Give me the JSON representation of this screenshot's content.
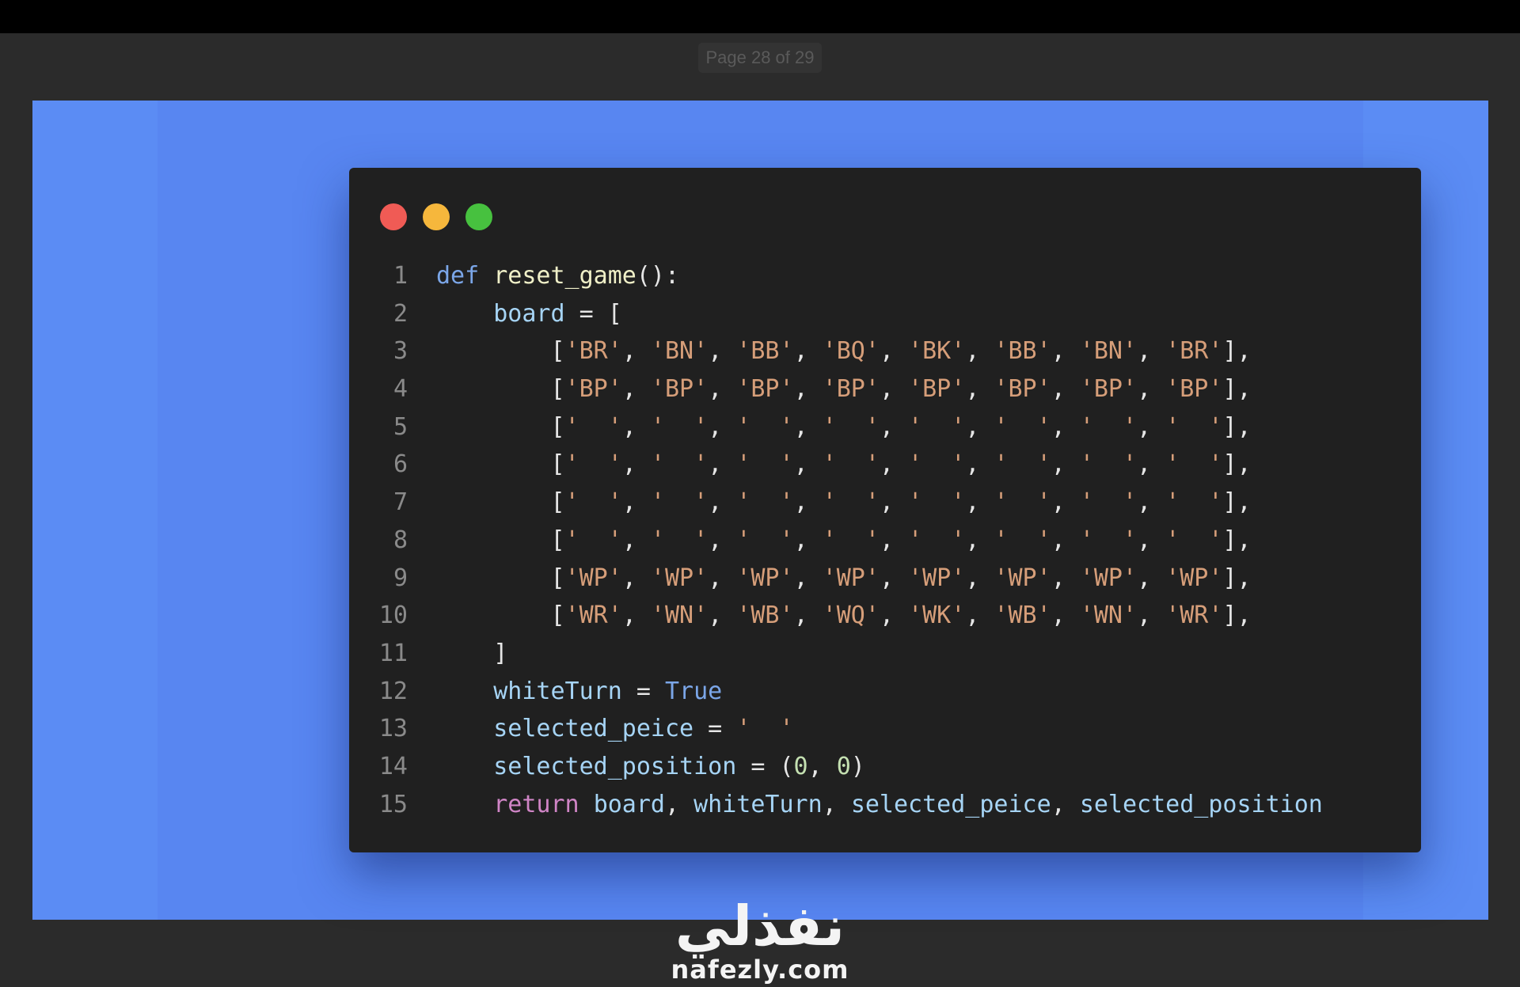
{
  "viewer": {
    "page_indicator": "Page 28 of 29"
  },
  "editor": {
    "window_controls": [
      "close",
      "minimize",
      "maximize"
    ],
    "colors": {
      "background": "#202020",
      "close": "#f05b55",
      "minimize": "#f6b73c",
      "maximize": "#47c13f"
    },
    "lines": [
      {
        "n": "1",
        "tokens": [
          {
            "t": "def",
            "c": "kw"
          },
          {
            "t": " ",
            "c": "op"
          },
          {
            "t": "reset_game",
            "c": "fn"
          },
          {
            "t": "():",
            "c": "op"
          }
        ]
      },
      {
        "n": "2",
        "tokens": [
          {
            "t": "    ",
            "c": "op"
          },
          {
            "t": "board",
            "c": "var"
          },
          {
            "t": " = [",
            "c": "op"
          }
        ]
      },
      {
        "n": "3",
        "tokens": [
          {
            "t": "        [",
            "c": "op"
          },
          {
            "t": "'BR'",
            "c": "str"
          },
          {
            "t": ", ",
            "c": "op"
          },
          {
            "t": "'BN'",
            "c": "str"
          },
          {
            "t": ", ",
            "c": "op"
          },
          {
            "t": "'BB'",
            "c": "str"
          },
          {
            "t": ", ",
            "c": "op"
          },
          {
            "t": "'BQ'",
            "c": "str"
          },
          {
            "t": ", ",
            "c": "op"
          },
          {
            "t": "'BK'",
            "c": "str"
          },
          {
            "t": ", ",
            "c": "op"
          },
          {
            "t": "'BB'",
            "c": "str"
          },
          {
            "t": ", ",
            "c": "op"
          },
          {
            "t": "'BN'",
            "c": "str"
          },
          {
            "t": ", ",
            "c": "op"
          },
          {
            "t": "'BR'",
            "c": "str"
          },
          {
            "t": "],",
            "c": "op"
          }
        ]
      },
      {
        "n": "4",
        "tokens": [
          {
            "t": "        [",
            "c": "op"
          },
          {
            "t": "'BP'",
            "c": "str"
          },
          {
            "t": ", ",
            "c": "op"
          },
          {
            "t": "'BP'",
            "c": "str"
          },
          {
            "t": ", ",
            "c": "op"
          },
          {
            "t": "'BP'",
            "c": "str"
          },
          {
            "t": ", ",
            "c": "op"
          },
          {
            "t": "'BP'",
            "c": "str"
          },
          {
            "t": ", ",
            "c": "op"
          },
          {
            "t": "'BP'",
            "c": "str"
          },
          {
            "t": ", ",
            "c": "op"
          },
          {
            "t": "'BP'",
            "c": "str"
          },
          {
            "t": ", ",
            "c": "op"
          },
          {
            "t": "'BP'",
            "c": "str"
          },
          {
            "t": ", ",
            "c": "op"
          },
          {
            "t": "'BP'",
            "c": "str"
          },
          {
            "t": "],",
            "c": "op"
          }
        ]
      },
      {
        "n": "5",
        "tokens": [
          {
            "t": "        [",
            "c": "op"
          },
          {
            "t": "'  '",
            "c": "str"
          },
          {
            "t": ", ",
            "c": "op"
          },
          {
            "t": "'  '",
            "c": "str"
          },
          {
            "t": ", ",
            "c": "op"
          },
          {
            "t": "'  '",
            "c": "str"
          },
          {
            "t": ", ",
            "c": "op"
          },
          {
            "t": "'  '",
            "c": "str"
          },
          {
            "t": ", ",
            "c": "op"
          },
          {
            "t": "'  '",
            "c": "str"
          },
          {
            "t": ", ",
            "c": "op"
          },
          {
            "t": "'  '",
            "c": "str"
          },
          {
            "t": ", ",
            "c": "op"
          },
          {
            "t": "'  '",
            "c": "str"
          },
          {
            "t": ", ",
            "c": "op"
          },
          {
            "t": "'  '",
            "c": "str"
          },
          {
            "t": "],",
            "c": "op"
          }
        ]
      },
      {
        "n": "6",
        "tokens": [
          {
            "t": "        [",
            "c": "op"
          },
          {
            "t": "'  '",
            "c": "str"
          },
          {
            "t": ", ",
            "c": "op"
          },
          {
            "t": "'  '",
            "c": "str"
          },
          {
            "t": ", ",
            "c": "op"
          },
          {
            "t": "'  '",
            "c": "str"
          },
          {
            "t": ", ",
            "c": "op"
          },
          {
            "t": "'  '",
            "c": "str"
          },
          {
            "t": ", ",
            "c": "op"
          },
          {
            "t": "'  '",
            "c": "str"
          },
          {
            "t": ", ",
            "c": "op"
          },
          {
            "t": "'  '",
            "c": "str"
          },
          {
            "t": ", ",
            "c": "op"
          },
          {
            "t": "'  '",
            "c": "str"
          },
          {
            "t": ", ",
            "c": "op"
          },
          {
            "t": "'  '",
            "c": "str"
          },
          {
            "t": "],",
            "c": "op"
          }
        ]
      },
      {
        "n": "7",
        "tokens": [
          {
            "t": "        [",
            "c": "op"
          },
          {
            "t": "'  '",
            "c": "str"
          },
          {
            "t": ", ",
            "c": "op"
          },
          {
            "t": "'  '",
            "c": "str"
          },
          {
            "t": ", ",
            "c": "op"
          },
          {
            "t": "'  '",
            "c": "str"
          },
          {
            "t": ", ",
            "c": "op"
          },
          {
            "t": "'  '",
            "c": "str"
          },
          {
            "t": ", ",
            "c": "op"
          },
          {
            "t": "'  '",
            "c": "str"
          },
          {
            "t": ", ",
            "c": "op"
          },
          {
            "t": "'  '",
            "c": "str"
          },
          {
            "t": ", ",
            "c": "op"
          },
          {
            "t": "'  '",
            "c": "str"
          },
          {
            "t": ", ",
            "c": "op"
          },
          {
            "t": "'  '",
            "c": "str"
          },
          {
            "t": "],",
            "c": "op"
          }
        ]
      },
      {
        "n": "8",
        "tokens": [
          {
            "t": "        [",
            "c": "op"
          },
          {
            "t": "'  '",
            "c": "str"
          },
          {
            "t": ", ",
            "c": "op"
          },
          {
            "t": "'  '",
            "c": "str"
          },
          {
            "t": ", ",
            "c": "op"
          },
          {
            "t": "'  '",
            "c": "str"
          },
          {
            "t": ", ",
            "c": "op"
          },
          {
            "t": "'  '",
            "c": "str"
          },
          {
            "t": ", ",
            "c": "op"
          },
          {
            "t": "'  '",
            "c": "str"
          },
          {
            "t": ", ",
            "c": "op"
          },
          {
            "t": "'  '",
            "c": "str"
          },
          {
            "t": ", ",
            "c": "op"
          },
          {
            "t": "'  '",
            "c": "str"
          },
          {
            "t": ", ",
            "c": "op"
          },
          {
            "t": "'  '",
            "c": "str"
          },
          {
            "t": "],",
            "c": "op"
          }
        ]
      },
      {
        "n": "9",
        "tokens": [
          {
            "t": "        [",
            "c": "op"
          },
          {
            "t": "'WP'",
            "c": "str"
          },
          {
            "t": ", ",
            "c": "op"
          },
          {
            "t": "'WP'",
            "c": "str"
          },
          {
            "t": ", ",
            "c": "op"
          },
          {
            "t": "'WP'",
            "c": "str"
          },
          {
            "t": ", ",
            "c": "op"
          },
          {
            "t": "'WP'",
            "c": "str"
          },
          {
            "t": ", ",
            "c": "op"
          },
          {
            "t": "'WP'",
            "c": "str"
          },
          {
            "t": ", ",
            "c": "op"
          },
          {
            "t": "'WP'",
            "c": "str"
          },
          {
            "t": ", ",
            "c": "op"
          },
          {
            "t": "'WP'",
            "c": "str"
          },
          {
            "t": ", ",
            "c": "op"
          },
          {
            "t": "'WP'",
            "c": "str"
          },
          {
            "t": "],",
            "c": "op"
          }
        ]
      },
      {
        "n": "10",
        "tokens": [
          {
            "t": "        [",
            "c": "op"
          },
          {
            "t": "'WR'",
            "c": "str"
          },
          {
            "t": ", ",
            "c": "op"
          },
          {
            "t": "'WN'",
            "c": "str"
          },
          {
            "t": ", ",
            "c": "op"
          },
          {
            "t": "'WB'",
            "c": "str"
          },
          {
            "t": ", ",
            "c": "op"
          },
          {
            "t": "'WQ'",
            "c": "str"
          },
          {
            "t": ", ",
            "c": "op"
          },
          {
            "t": "'WK'",
            "c": "str"
          },
          {
            "t": ", ",
            "c": "op"
          },
          {
            "t": "'WB'",
            "c": "str"
          },
          {
            "t": ", ",
            "c": "op"
          },
          {
            "t": "'WN'",
            "c": "str"
          },
          {
            "t": ", ",
            "c": "op"
          },
          {
            "t": "'WR'",
            "c": "str"
          },
          {
            "t": "],",
            "c": "op"
          }
        ]
      },
      {
        "n": "11",
        "tokens": [
          {
            "t": "    ]",
            "c": "op"
          }
        ]
      },
      {
        "n": "12",
        "tokens": [
          {
            "t": "    ",
            "c": "op"
          },
          {
            "t": "whiteTurn",
            "c": "var"
          },
          {
            "t": " = ",
            "c": "op"
          },
          {
            "t": "True",
            "c": "kw"
          }
        ]
      },
      {
        "n": "13",
        "tokens": [
          {
            "t": "    ",
            "c": "op"
          },
          {
            "t": "selected_peice",
            "c": "var"
          },
          {
            "t": " = ",
            "c": "op"
          },
          {
            "t": "'  '",
            "c": "str"
          }
        ]
      },
      {
        "n": "14",
        "tokens": [
          {
            "t": "    ",
            "c": "op"
          },
          {
            "t": "selected_position",
            "c": "var"
          },
          {
            "t": " = (",
            "c": "op"
          },
          {
            "t": "0",
            "c": "num"
          },
          {
            "t": ", ",
            "c": "op"
          },
          {
            "t": "0",
            "c": "num"
          },
          {
            "t": ")",
            "c": "op"
          }
        ]
      },
      {
        "n": "15",
        "tokens": [
          {
            "t": "    ",
            "c": "op"
          },
          {
            "t": "return",
            "c": "ret"
          },
          {
            "t": " ",
            "c": "op"
          },
          {
            "t": "board",
            "c": "var"
          },
          {
            "t": ", ",
            "c": "op"
          },
          {
            "t": "whiteTurn",
            "c": "var"
          },
          {
            "t": ", ",
            "c": "op"
          },
          {
            "t": "selected_peice",
            "c": "var"
          },
          {
            "t": ", ",
            "c": "op"
          },
          {
            "t": "selected_position",
            "c": "var"
          }
        ]
      }
    ]
  },
  "watermark": {
    "arabic": "نفذلي",
    "latin": "nafezly.com"
  },
  "colors": {
    "slide_background": "#5b8cf4",
    "viewer_background": "#2b2b2b"
  }
}
